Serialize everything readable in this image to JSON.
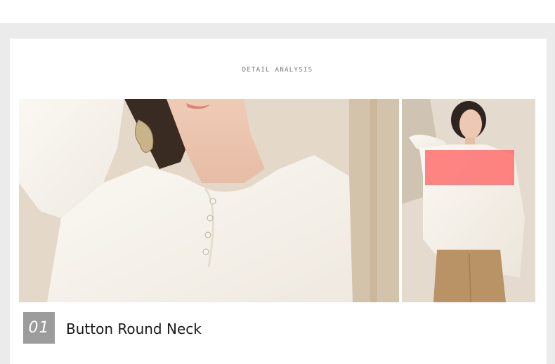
{
  "detail": {
    "section_title": "DETAIL ANALYSIS",
    "feature_number": "01",
    "feature_title": "Button Round Neck"
  },
  "images": {
    "main": "sweater-neckline-closeup",
    "side": "model-full-upper-body"
  },
  "colors": {
    "frame": "#ebebeb",
    "number_box": "#9c9c9c",
    "highlight": "#ff6464"
  }
}
